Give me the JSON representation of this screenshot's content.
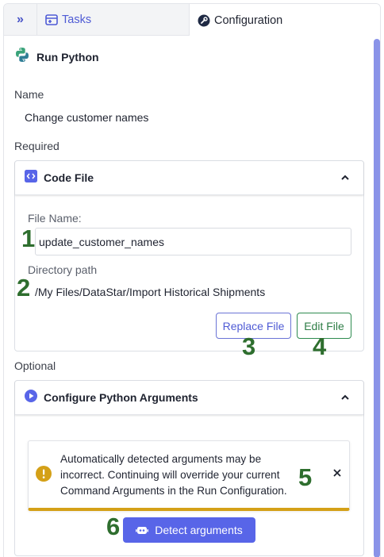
{
  "tabs": {
    "collapse_icon": "double-chevron-right-icon",
    "tasks_label": "Tasks",
    "configuration_label": "Configuration"
  },
  "task": {
    "title": "Run Python",
    "icon": "python-icon"
  },
  "name_section": {
    "label": "Name",
    "value": "Change customer names"
  },
  "required_section": {
    "label": "Required",
    "card_title": "Code File",
    "file_name_label": "File Name:",
    "file_name_value": "update_customer_names",
    "directory_label": "Directory path",
    "directory_value": "/My Files/DataStar/Import Historical Shipments",
    "replace_button": "Replace File",
    "edit_button": "Edit File"
  },
  "optional_section": {
    "label": "Optional",
    "card_title": "Configure Python Arguments",
    "warning_text": "Automatically detected arguments may be incorrect. Continuing will override your current Command Arguments in the Run Configuration.",
    "detect_button": "Detect arguments"
  },
  "markers": {
    "m1": "1",
    "m2": "2",
    "m3": "3",
    "m4": "4",
    "m5": "5",
    "m6": "6"
  },
  "colors": {
    "accent": "#5865e8",
    "marker": "#2e6e2e",
    "warning": "#d4a017",
    "edit_green": "#2e7d46"
  }
}
